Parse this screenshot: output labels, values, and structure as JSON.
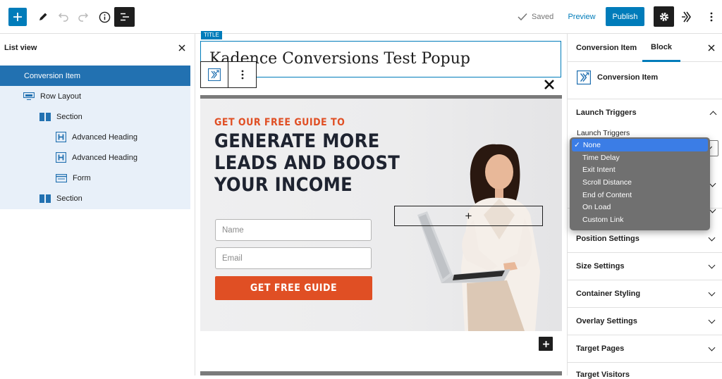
{
  "topbar": {
    "saved_label": "Saved",
    "preview_label": "Preview",
    "publish_label": "Publish",
    "accent_color": "#007cba",
    "icons": [
      "plus-icon",
      "pencil-icon",
      "undo-icon",
      "redo-icon",
      "info-icon",
      "list-view-icon",
      "check-icon",
      "gear-icon",
      "kadence-icon",
      "more-vertical-icon"
    ]
  },
  "list_view": {
    "title": "List view",
    "items": [
      {
        "label": "Conversion Item",
        "icon": "none"
      },
      {
        "label": "Row Layout",
        "icon": "row-layout-icon"
      },
      {
        "label": "Section",
        "icon": "section-icon"
      },
      {
        "label": "Advanced Heading",
        "icon": "heading-icon"
      },
      {
        "label": "Advanced Heading",
        "icon": "heading-icon"
      },
      {
        "label": "Form",
        "icon": "form-icon"
      },
      {
        "label": "Section",
        "icon": "section-icon"
      }
    ]
  },
  "canvas": {
    "title_tag": "TITLE",
    "post_title": "Kadence Conversions Test Popup",
    "eyebrow": "GET OUR FREE GUIDE TO",
    "headline_lines": [
      "GENERATE MORE",
      "LEADS AND BOOST",
      "YOUR INCOME"
    ],
    "name_placeholder": "Name",
    "email_placeholder": "Email",
    "cta_label": "GET FREE GUIDE",
    "plus_glyph": "+",
    "close_glyph": "✕",
    "brand_orange": "#e04f24"
  },
  "sidebar": {
    "tabs": [
      "Conversion Item",
      "Block"
    ],
    "active_tab": "Block",
    "block_name": "Conversion Item",
    "launch_triggers_title": "Launch Triggers",
    "launch_triggers_label": "Launch Triggers",
    "sections": [
      "Position Settings",
      "Size Settings",
      "Container Styling",
      "Overlay Settings",
      "Target Pages"
    ],
    "cut_off_section": "Target Visitors"
  },
  "trigger_dropdown": {
    "selected": "None",
    "options": [
      "None",
      "Time Delay",
      "Exit Intent",
      "Scroll Distance",
      "End of Content",
      "On Load",
      "Custom Link"
    ]
  }
}
